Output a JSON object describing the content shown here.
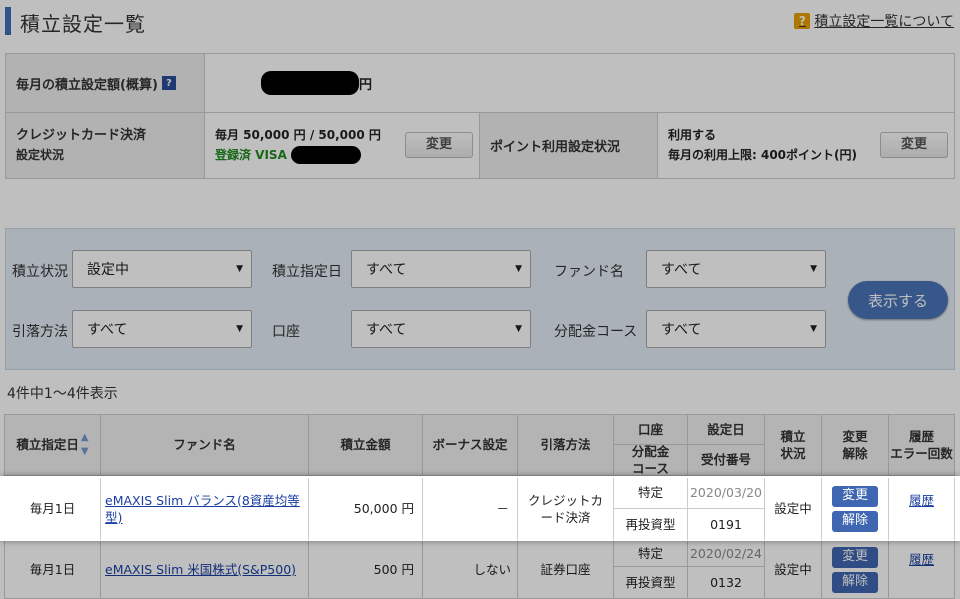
{
  "header": {
    "title": "積立設定一覧",
    "help_link": "積立設定一覧について",
    "help_icon": "?"
  },
  "summary": {
    "monthly_label": "毎月の積立設定額(概算)",
    "monthly_help_icon": "?",
    "monthly_unit": "円",
    "credit_label_line1": "クレジットカード決済",
    "credit_label_line2": "設定状況",
    "credit_amount": "毎月 50,000 円 / 50,000 円",
    "credit_status": "登録済 VISA",
    "credit_change": "変更",
    "point_label": "ポイント利用設定状況",
    "point_use": "利用する",
    "point_limit": "毎月の利用上限: 400ポイント(円)",
    "point_change": "変更"
  },
  "filter": {
    "status_label": "積立状況",
    "status_value": "設定中",
    "date_label": "積立指定日",
    "date_value": "すべて",
    "fund_label": "ファンド名",
    "fund_value": "すべて",
    "method_label": "引落方法",
    "method_value": "すべて",
    "account_label": "口座",
    "account_value": "すべて",
    "course_label": "分配金コース",
    "course_value": "すべて",
    "show_button": "表示する"
  },
  "count_text": "4件中1～4件表示",
  "table": {
    "headers": {
      "date": "積立指定日",
      "fund": "ファンド名",
      "amount": "積立金額",
      "bonus": "ボーナス設定",
      "method": "引落方法",
      "account": "口座",
      "course_1": "分配金",
      "course_2": "コース",
      "setdate": "設定日",
      "receipt": "受付番号",
      "status_1": "積立",
      "status_2": "状況",
      "change_1": "変更",
      "change_2": "解除",
      "history_1": "履歴",
      "history_2": "エラー回数"
    },
    "rows": [
      {
        "date": "毎月1日",
        "fund": "eMAXIS Slim バランス(8資産均等型)",
        "amount": "50,000 円",
        "bonus": "－",
        "method": "クレジットカード決済",
        "account": "特定",
        "course": "再投資型",
        "setdate": "2020/03/20",
        "receipt": "0191",
        "status": "設定中",
        "change": "変更",
        "cancel": "解除",
        "history": "履歴"
      },
      {
        "date": "毎月1日",
        "fund": "eMAXIS Slim 米国株式(S&P500)",
        "amount": "500 円",
        "bonus": "しない",
        "method": "証券口座",
        "account": "特定",
        "course": "再投資型",
        "setdate": "2020/02/24",
        "receipt": "0132",
        "status": "設定中",
        "change": "変更",
        "cancel": "解除",
        "history": "履歴"
      }
    ]
  },
  "colors": {
    "accent": "#3c6fb8",
    "button_blue": "#3f66b0",
    "link": "#1a3fa0",
    "registered_green": "#1f8a1f"
  }
}
